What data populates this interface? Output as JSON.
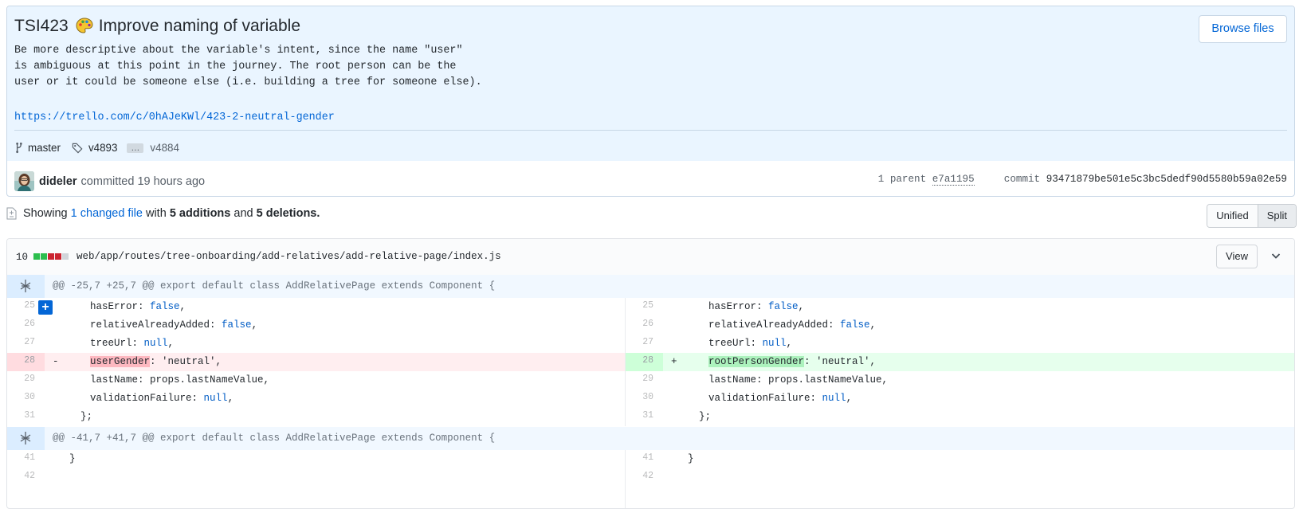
{
  "commit": {
    "title": "TSI423",
    "title_rest": "Improve naming of variable",
    "description": "Be more descriptive about the variable's intent, since the name \"user\"\nis ambiguous at this point in the journey. The root person can be the\nuser or it could be someone else (i.e. building a tree for someone else).",
    "link": "https://trello.com/c/0hAJeKWl/423-2-neutral-gender",
    "branch": "master",
    "tag_start": "v4893",
    "tag_ellipsis": "…",
    "tag_end": "v4884",
    "browse_label": "Browse files",
    "author": "dideler",
    "committed_text": "committed 19 hours ago",
    "parent_label": "1 parent",
    "parent_sha": "e7a1195",
    "commit_label": "commit",
    "commit_sha": "93471879be501e5c3bc5dedf90d5580b59a02e59"
  },
  "summary": {
    "showing": "Showing",
    "changed": "1 changed file",
    "with": "with",
    "additions": "5 additions",
    "and": "and",
    "deletions": "5 deletions."
  },
  "view_toggle": {
    "unified": "Unified",
    "split": "Split"
  },
  "file": {
    "count": "10",
    "path": "web/app/routes/tree-onboarding/add-relatives/add-relative-page/index.js",
    "view_label": "View"
  },
  "hunks": [
    "@@ -25,7 +25,7 @@ export default class AddRelativePage extends Component {",
    "@@ -41,7 +41,7 @@ export default class AddRelativePage extends Component {"
  ],
  "diff": {
    "r25": {
      "num": "25",
      "a": "hasError",
      "b": ": ",
      "c": "false",
      "d": ","
    },
    "r26": {
      "num": "26",
      "a": "relativeAlreadyAdded",
      "b": ": ",
      "c": "false",
      "d": ","
    },
    "r27": {
      "num": "27",
      "a": "treeUrl",
      "b": ": ",
      "c": "null",
      "d": ","
    },
    "r28_left": {
      "num": "28",
      "mark": "-",
      "name": "userGender",
      "rest": ": 'neutral',"
    },
    "r28_right": {
      "num": "28",
      "mark": "+",
      "name": "rootPersonGender",
      "rest": ": 'neutral',"
    },
    "r29": {
      "num": "29",
      "text": "lastName: props.lastNameValue,"
    },
    "r30": {
      "num": "30",
      "a": "validationFailure",
      "b": ": ",
      "c": "null",
      "d": ","
    },
    "r31": {
      "num": "31",
      "text": "};"
    },
    "r41": {
      "num": "41",
      "text": "}"
    },
    "r42": {
      "num": "42"
    }
  }
}
